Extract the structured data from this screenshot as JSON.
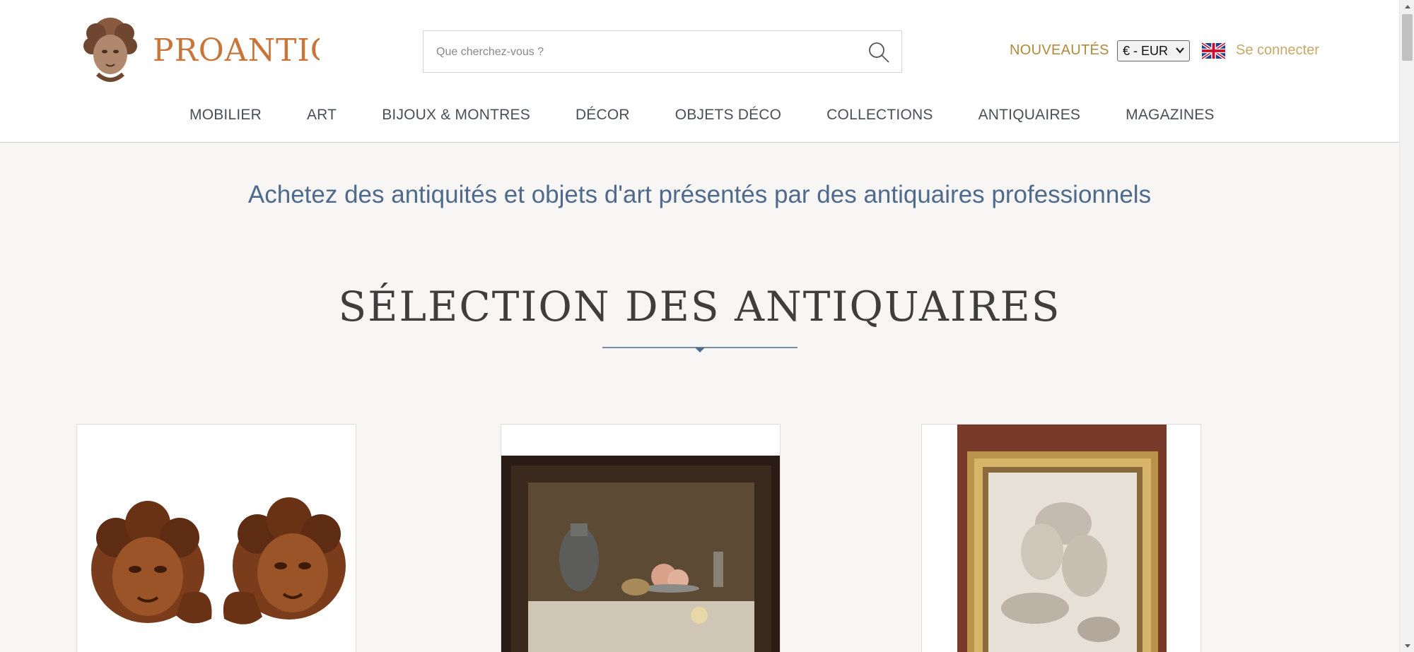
{
  "header": {
    "logo_text": "PROANTIC",
    "search": {
      "placeholder": "Que cherchez-vous ?",
      "icon": "search-icon"
    },
    "nouveautes_label": "NOUVEAUTÉS",
    "currency": {
      "selected": "€ - EUR"
    },
    "language_flag": "uk-flag-icon",
    "login_label": "Se connecter"
  },
  "nav": {
    "items": [
      {
        "label": "MOBILIER"
      },
      {
        "label": "ART"
      },
      {
        "label": "BIJOUX & MONTRES"
      },
      {
        "label": "DÉCOR"
      },
      {
        "label": "OBJETS DÉCO"
      },
      {
        "label": "COLLECTIONS"
      },
      {
        "label": "ANTIQUAIRES"
      },
      {
        "label": "MAGAZINES"
      }
    ]
  },
  "main": {
    "tagline": "Achetez des antiquités et objets d'art présentés par des antiquaires professionnels",
    "section_title": "SÉLECTION DES ANTIQUAIRES",
    "products": [
      {
        "image": "carved-wooden-cherub-heads"
      },
      {
        "image": "still-life-painting-framed"
      },
      {
        "image": "drawing-in-gilt-frame"
      }
    ]
  },
  "colors": {
    "accent_gold": "#b08a3a",
    "logo_orange": "#c9753a",
    "tagline_blue": "#4e6a8c",
    "nav_text": "#4a4f55"
  }
}
